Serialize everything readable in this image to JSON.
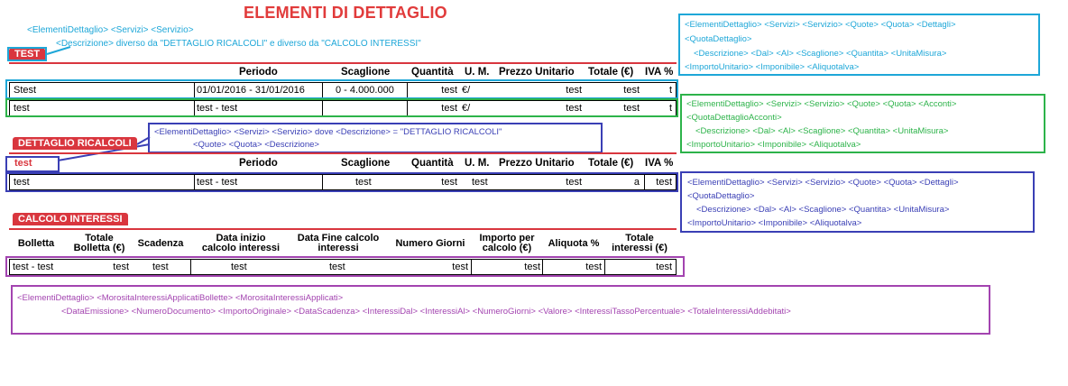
{
  "title": "ELEMENTI DI DETTAGLIO",
  "top_note": {
    "line1": "<ElementiDettaglio> <Servizi> <Servizio>",
    "line2": "<Descrizione> diverso da \"DETTAGLIO RICALCOLI\" e diverso da \"CALCOLO INTERESSI\""
  },
  "section1": {
    "tag": "TEST",
    "headers": [
      "Periodo",
      "Scaglione",
      "Quantità",
      "U. M.",
      "Prezzo Unitario",
      "Totale (€)",
      "IVA %"
    ],
    "row1": [
      "Stest",
      "01/01/2016 - 31/01/2016",
      "0 - 4.000.000",
      "test",
      "€/",
      "test",
      "test",
      "t"
    ],
    "row2": [
      "test",
      "test - test",
      "",
      "test",
      "€/",
      "test",
      "test",
      "t"
    ]
  },
  "section2": {
    "tag": "DETTAGLIO RICALCOLI",
    "subtag": "test",
    "note_line1": "<ElementiDettaglio> <Servizi> <Servizio> dove <Descrizione> = \"DETTAGLIO RICALCOLI\"",
    "note_line2": "<Quote> <Quota> <Descrizione>",
    "headers": [
      "Periodo",
      "Scaglione",
      "Quantità",
      "U. M.",
      "Prezzo Unitario",
      "Totale (€)",
      "IVA %"
    ],
    "row": [
      "test",
      "test - test",
      "test",
      "test",
      "test",
      "test",
      "a",
      "test"
    ]
  },
  "section3": {
    "tag": "CALCOLO INTERESSI",
    "headers": [
      {
        "l1": "Bolletta",
        "l2": ""
      },
      {
        "l1": "Totale",
        "l2": "Bolletta (€)"
      },
      {
        "l1": "Scadenza",
        "l2": ""
      },
      {
        "l1": "Data inizio",
        "l2": "calcolo interessi"
      },
      {
        "l1": "Data Fine calcolo",
        "l2": "interessi"
      },
      {
        "l1": "Numero Giorni",
        "l2": ""
      },
      {
        "l1": "Importo per",
        "l2": "calcolo (€)"
      },
      {
        "l1": "Aliquota %",
        "l2": ""
      },
      {
        "l1": "Totale",
        "l2": "interessi (€)"
      }
    ],
    "row": [
      "test - test",
      "test",
      "test",
      "test",
      "test",
      "test",
      "test",
      "test",
      "test"
    ]
  },
  "box_blue_top": {
    "line1": "<ElementiDettaglio> <Servizi> <Servizio> <Quote> <Quota> <Dettagli>",
    "line2": "<QuotaDettaglio>",
    "line3": "<Descrizione>  <Dal> <Al> <Scaglione> <Quantita> <UnitaMisura>",
    "line4": "<ImportoUnitario> <Imponibile> <Aliquotalva>"
  },
  "box_green": {
    "line1": "<ElementiDettaglio> <Servizi> <Servizio> <Quote> <Quota> <Acconti>",
    "line2": "<QuotaDettaglioAcconti>",
    "line3": "<Descrizione>  <Dal> <Al> <Scaglione> <Quantita> <UnitaMisura>",
    "line4": "<ImportoUnitario> <Imponibile> <Aliquotalva>"
  },
  "box_navy": {
    "line1": "<ElementiDettaglio> <Servizi> <Servizio> <Quote> <Quota> <Dettagli>",
    "line2": "<QuotaDettaglio>",
    "line3": "<Descrizione>  <Dal> <Al> <Scaglione> <Quantita> <UnitaMisura>",
    "line4": "<ImportoUnitario> <Imponibile> <Aliquotalva>"
  },
  "box_purple": {
    "line1": "<ElementiDettaglio> <MorositaInteressiApplicatiBollette> <MorositaInteressiApplicati>",
    "line2": "<DataEmissione> <NumeroDocumento> <ImportoOriginale> <DataScadenza> <InteressiDal> <InteressiAl> <NumeroGiorni> <Valore> <InteressiTassoPercentuale> <TotaleInteressiAddebitati>"
  },
  "colors": {
    "red": "#d9363e",
    "cyan": "#1ea7d8",
    "green": "#2db34a",
    "navy": "#3a3fb5",
    "purple": "#a344b0"
  }
}
